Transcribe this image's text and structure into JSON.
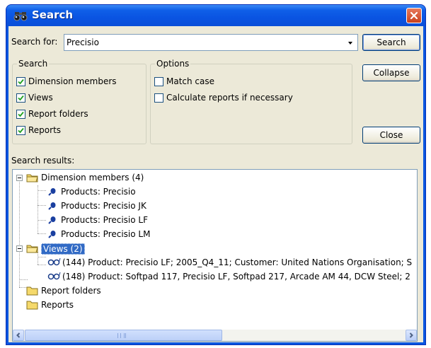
{
  "window": {
    "title": "Search",
    "close_tooltip": ""
  },
  "search_for": {
    "label": "Search for:",
    "value": "Precisio"
  },
  "buttons": {
    "search": "Search",
    "collapse": "Collapse",
    "close": "Close"
  },
  "search_group": {
    "title": "Search",
    "items": [
      {
        "label": "Dimension members",
        "checked": true
      },
      {
        "label": "Views",
        "checked": true
      },
      {
        "label": "Report folders",
        "checked": true
      },
      {
        "label": "Reports",
        "checked": true
      }
    ]
  },
  "options_group": {
    "title": "Options",
    "items": [
      {
        "label": "Match case",
        "checked": false
      },
      {
        "label": "Calculate reports if necessary",
        "checked": false
      }
    ]
  },
  "results": {
    "label": "Search results:",
    "tree": [
      {
        "label": "Dimension members (4)",
        "expanded": true,
        "selected": false,
        "children": [
          "Products: Precisio",
          "Products: Precisio JK",
          "Products: Precisio LF",
          "Products: Precisio LM"
        ]
      },
      {
        "label": "Views (2)",
        "expanded": true,
        "selected": true,
        "children": [
          "(144) Product: Precisio LF; 2005_Q4_11; Customer: United Nations Organisation; S",
          "(148) Product: Softpad 117, Precisio LF, Softpad 217, Arcade AM 44, DCW Steel; 2"
        ]
      },
      {
        "label": "Report folders",
        "expanded": false,
        "selected": false,
        "children": []
      },
      {
        "label": "Reports",
        "expanded": false,
        "selected": false,
        "children": []
      }
    ]
  },
  "colors": {
    "titlebar": "#0a54e2",
    "dialog": "#ece9d8",
    "selection": "#316ac5",
    "close_button": "#c9411d"
  },
  "icons": {
    "title": "binoculars-icon",
    "member": "dimension-member-icon",
    "view": "view-glasses-icon",
    "folder": "folder-icon"
  }
}
